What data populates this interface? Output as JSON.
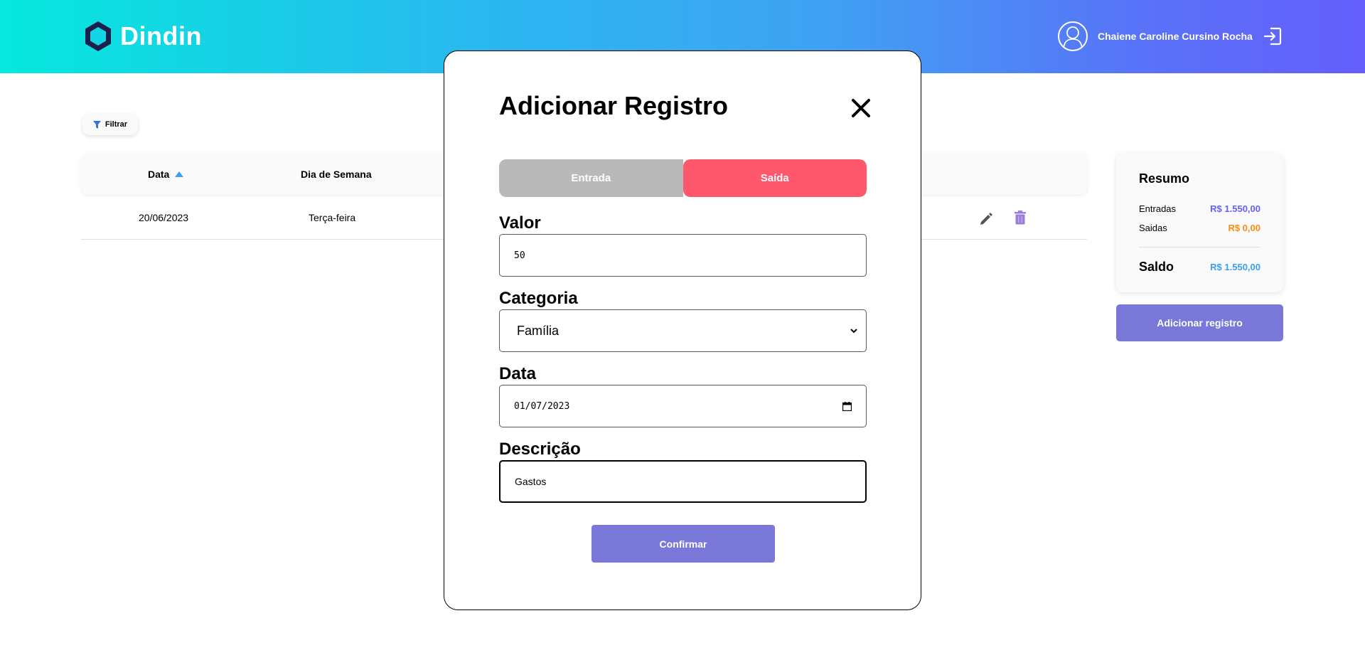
{
  "header": {
    "app_name": "Dindin",
    "user_name": "Chaiene Caroline Cursino Rocha"
  },
  "toolbar": {
    "filter_label": "Filtrar"
  },
  "table": {
    "columns": [
      "Data",
      "Dia de Semana"
    ],
    "rows": [
      {
        "date": "20/06/2023",
        "weekday": "Terça-feira"
      }
    ]
  },
  "summary": {
    "title": "Resumo",
    "entradas_label": "Entradas",
    "entradas_value": "R$ 1.550,00",
    "saidas_label": "Saidas",
    "saidas_value": "R$ 0,00",
    "saldo_label": "Saldo",
    "saldo_value": "R$ 1.550,00",
    "add_button_label": "Adicionar registro"
  },
  "modal": {
    "title": "Adicionar Registro",
    "toggle_in_label": "Entrada",
    "toggle_out_label": "Saída",
    "valor_label": "Valor",
    "valor_value": "50",
    "categoria_label": "Categoria",
    "categoria_value": "Família",
    "data_label": "Data",
    "data_value": "01/07/2023",
    "descricao_label": "Descrição",
    "descricao_value": "Gastos",
    "confirm_label": "Confirmar"
  },
  "colors": {
    "accent_purple": "#7978d9",
    "saida_red": "#ff576b",
    "entradas_value": "#645ffb",
    "saidas_value": "#fa8c10",
    "saldo_value": "#3a9ff1",
    "sort_arrow": "#3a9ff1",
    "trash_icon": "#9b7ed8"
  }
}
